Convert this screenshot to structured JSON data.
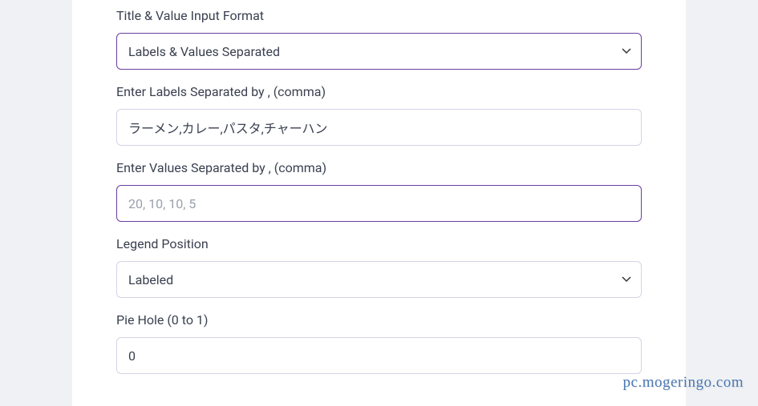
{
  "form": {
    "titleFormat": {
      "label": "Title & Value Input Format",
      "value": "Labels & Values Separated"
    },
    "labels": {
      "label": "Enter Labels Separated by , (comma)",
      "value": "ラーメン,カレー,パスタ,チャーハン"
    },
    "values": {
      "label": "Enter Values Separated by , (comma)",
      "placeholder": "20, 10, 10, 5",
      "value": ""
    },
    "legendPosition": {
      "label": "Legend Position",
      "value": "Labeled"
    },
    "pieHole": {
      "label": "Pie Hole (0 to 1)",
      "value": "0"
    }
  },
  "watermark": "pc.mogeringo.com"
}
